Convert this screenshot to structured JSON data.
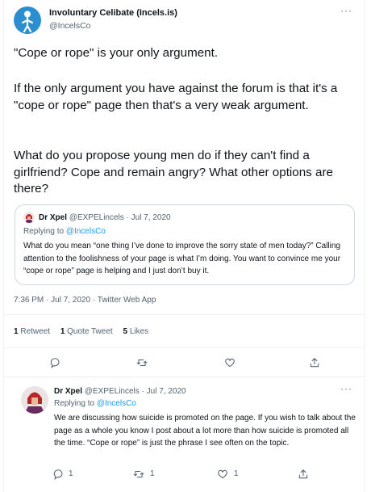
{
  "main_tweet": {
    "author_name": "Involuntary Celibate (Incels.is)",
    "author_handle": "@IncelsCo",
    "paragraphs": [
      "\"Cope or rope\" is your only argument.",
      "If the only argument you have against the forum is that it's a \"cope or rope\" page then that's a very weak argument.",
      "What do you propose young men do if they can't find a girlfriend? Cope and remain angry? What other options are there?"
    ],
    "timestamp": "7:36 PM · Jul 7, 2020 · Twitter Web App",
    "stats": {
      "retweets_count": "1",
      "retweets_label": "Retweet",
      "quotes_count": "1",
      "quotes_label": "Quote Tweet",
      "likes_count": "5",
      "likes_label": "Likes"
    }
  },
  "quote": {
    "author_name": "Dr Xpel",
    "author_handle": "@EXPELincels · Jul 7, 2020",
    "replying_prefix": "Replying to ",
    "replying_handle": "@IncelsCo",
    "text": "What do you mean “one thing I’ve done to improve the sorry state of men today?” Calling attention to the foolishness of your page is what I’m doing. You want to convince me your “cope or rope” page is helping and I just don’t buy it."
  },
  "reply": {
    "author_name": "Dr Xpel",
    "author_handle": "@EXPELincels · Jul 7, 2020",
    "replying_prefix": "Replying to ",
    "replying_handle": "@IncelsCo",
    "text": "We are discussing how suicide is promoted on the page. If you wish to talk about the page as a whole you know I post about a lot more than how suicide is promoted all the time. “Cope or rope” is just the phrase I see often on the topic.",
    "reply_count": "1",
    "retweet_count": "1",
    "like_count": "1"
  },
  "more_label": "···",
  "icons": [
    "reply-icon",
    "retweet-icon",
    "like-icon",
    "share-icon",
    "more-icon"
  ],
  "colors": {
    "link": "#1d9bf0",
    "secondary": "#536471",
    "avatar_blue": "#2b8fcf"
  }
}
